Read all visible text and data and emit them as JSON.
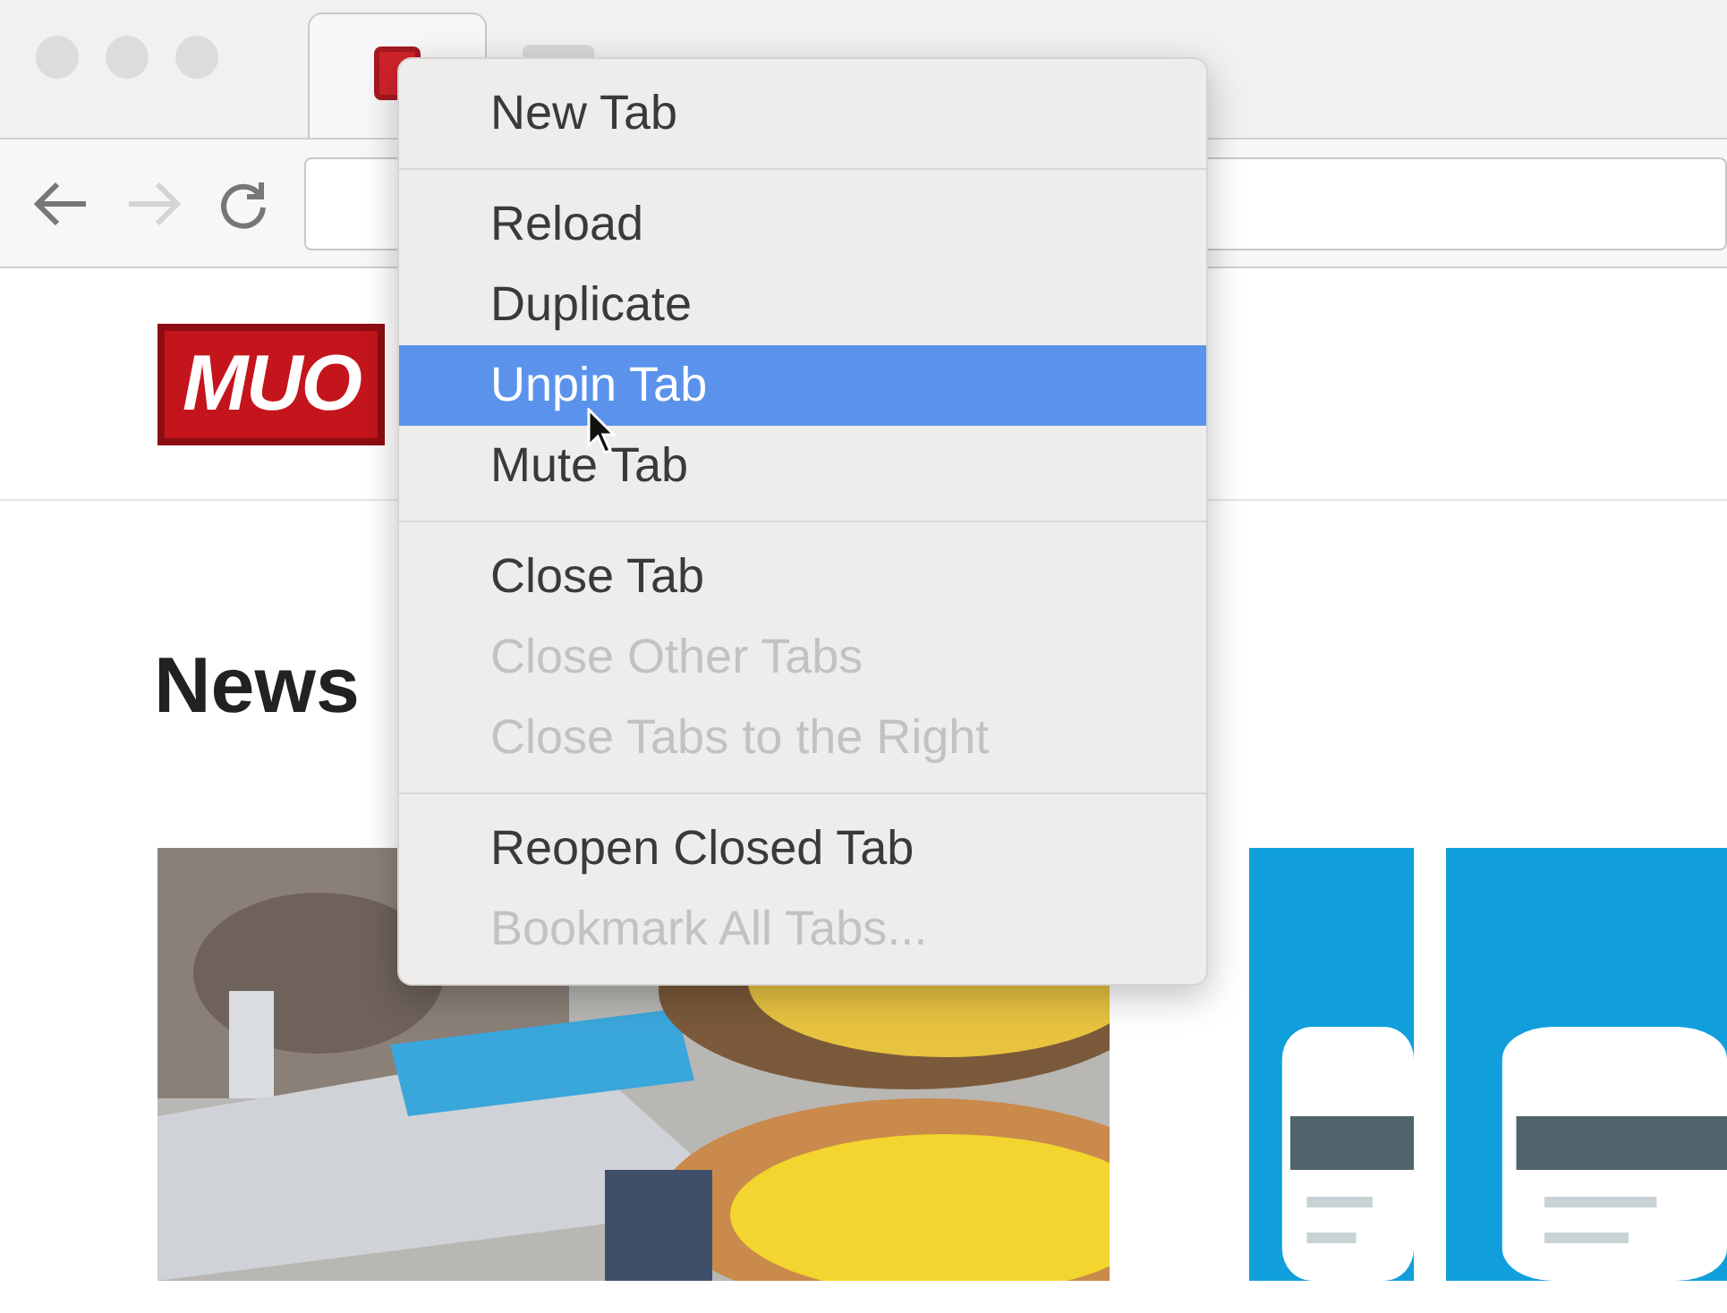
{
  "window": {
    "tabs": [
      {
        "selected": true
      },
      {
        "selected": false
      }
    ]
  },
  "page": {
    "logo": "MUO",
    "heading": "News"
  },
  "context_menu": {
    "groups": [
      {
        "items": [
          {
            "label": "New Tab",
            "selected": false,
            "disabled": false
          }
        ]
      },
      {
        "items": [
          {
            "label": "Reload",
            "selected": false,
            "disabled": false
          },
          {
            "label": "Duplicate",
            "selected": false,
            "disabled": false
          },
          {
            "label": "Unpin Tab",
            "selected": true,
            "disabled": false
          },
          {
            "label": "Mute Tab",
            "selected": false,
            "disabled": false
          }
        ]
      },
      {
        "items": [
          {
            "label": "Close Tab",
            "selected": false,
            "disabled": false
          },
          {
            "label": "Close Other Tabs",
            "selected": false,
            "disabled": true
          },
          {
            "label": "Close Tabs to the Right",
            "selected": false,
            "disabled": true
          }
        ]
      },
      {
        "items": [
          {
            "label": "Reopen Closed Tab",
            "selected": false,
            "disabled": false
          },
          {
            "label": "Bookmark All Tabs...",
            "selected": false,
            "disabled": true
          }
        ]
      }
    ]
  }
}
